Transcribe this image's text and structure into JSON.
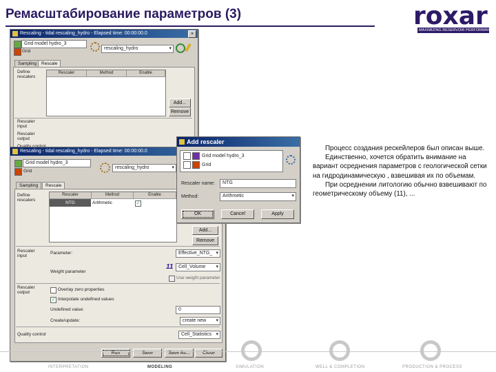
{
  "slide": {
    "title": "Ремасштабирование параметров (3)",
    "logo_text": "roxar",
    "logo_tagline": "MAXIMIZING RESERVOIR PERFORMANCE"
  },
  "win1": {
    "title": "Rescaling - tidal rescaling_hydro - Elapsed time: 00:00:00.0",
    "tree_item1": "Grid model hydro_3",
    "tree_item2": "Grid",
    "dropdown": "rescaling_hydro",
    "tabs": [
      "Sampling",
      "Rescale"
    ],
    "left_labels": [
      "Define",
      "rescalers"
    ],
    "columns": [
      "Rescaler",
      "Method",
      "Enable"
    ],
    "btn_add": "Add...",
    "btn_remove": "Remove",
    "lower_labels": [
      "Rescaler",
      "input",
      "Rescaler",
      "output",
      "Quality control"
    ]
  },
  "win2": {
    "title": "Rescaling - tidal rescaling_hydro - Elapsed time: 00:00:00.0",
    "tree_item1": "Grid model hydro_3",
    "tree_item2": "Grid",
    "dropdown": "rescaling_hydro",
    "tabs": [
      "Sampling",
      "Rescale"
    ],
    "define_label": [
      "Define",
      "rescalers"
    ],
    "columns": [
      "Rescaler",
      "Method",
      "Enable"
    ],
    "row": {
      "rescaler": "NTG",
      "method": "Arithmetic",
      "enable": "✓"
    },
    "btn_add": "Add...",
    "btn_remove": "Remove",
    "rescaler_input_label": [
      "Rescaler",
      "input"
    ],
    "parameter_label": "Parameter:",
    "parameter_value": "Effective_NTG_",
    "weight_label": "Weight parameter",
    "weight_value": "Cell_Volume",
    "annotation": "11",
    "use_label": "Use weight parameter",
    "rescaler_output_label": [
      "Rescaler",
      "output"
    ],
    "opt1": "Overlay zero properties",
    "opt2": "Interpolate undefined values",
    "undefined_label": "Undefined value:",
    "undefined_value": "0",
    "create_update_label": "Create/update:",
    "create_update_value": "create new",
    "qc_label": "Quality control",
    "qc_value": "Cell_Statistics",
    "buttons": [
      "Run",
      "Save",
      "Save As...",
      "Close"
    ]
  },
  "dialog": {
    "title": "Add rescaler",
    "item1": "Grid model hydro_3",
    "item2": "Grid",
    "name_label": "Rescaler name:",
    "name_value": "NTG",
    "method_label": "Method:",
    "method_value": "Arithmetic",
    "buttons": [
      "OK",
      "Cancel",
      "Apply"
    ]
  },
  "text": {
    "p1": "Процесс создания рескейлеров был описан выше.",
    "p2": "Единственно, хочется обратить внимание на вариант осреднения параметров с геологической сетки на гидродинамическую , взвешивая их по объемам.",
    "p3": "При осреднении литологию обычно взвешивают по геометрическому объему (11), ..."
  },
  "footer": {
    "items": [
      "INTERPRETATION",
      "MODELING",
      "SIMULATION",
      "WELL & COMPLETION",
      "PRODUCTION & PROCESS"
    ]
  },
  "colors": {
    "brand": "#2d1a67",
    "titlebar": "#0a246a",
    "annotation": "#2a1aa0",
    "selection": "#7030a0"
  }
}
